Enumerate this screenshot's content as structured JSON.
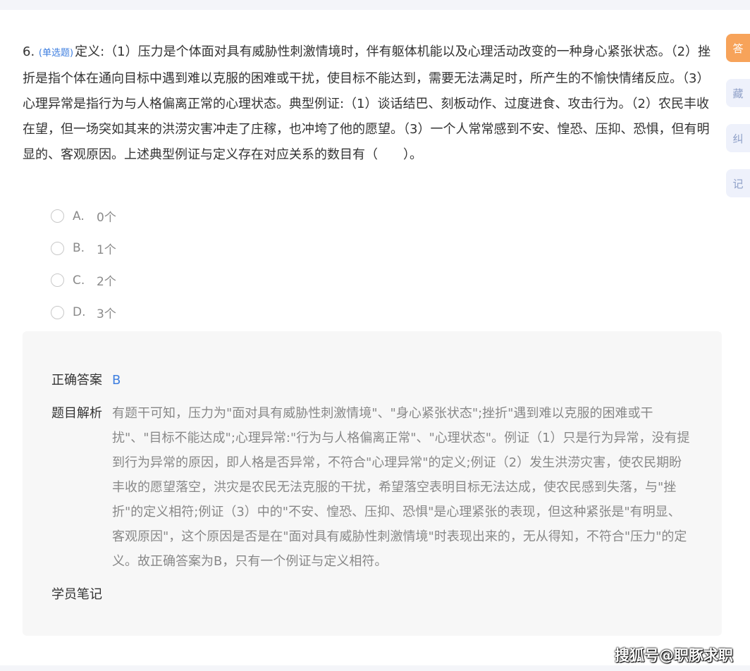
{
  "question": {
    "number": "6.",
    "type": "(单选题)",
    "text": "定义:（1）压力是个体面对具有威胁性刺激情境时，伴有躯体机能以及心理活动改变的一种身心紧张状态。（2）挫折是指个体在通向目标中遇到难以克服的困难或干扰，使目标不能达到，需要无法满足时，所产生的不愉快情绪反应。（3）心理异常是指行为与人格偏离正常的心理状态。典型例证:（1）谈话结巴、刻板动作、过度进食、攻击行为。（2）农民丰收在望，但一场突如其来的洪涝灾害冲走了庄稼，也冲垮了他的愿望。（3）一个人常常感到不安、惶恐、压抑、恐惧，但有明显的、客观原因。上述典型例证与定义存在对应关系的数目有（　　）。"
  },
  "options": [
    {
      "letter": "A.",
      "text": "0个"
    },
    {
      "letter": "B.",
      "text": "1个"
    },
    {
      "letter": "C.",
      "text": "2个"
    },
    {
      "letter": "D.",
      "text": "3个"
    }
  ],
  "analysis": {
    "answer_label": "正确答案",
    "answer_value": "B",
    "explanation_label": "题目解析",
    "explanation_text": "有题干可知，压力为\"面对具有威胁性刺激情境\"、\"身心紧张状态\";挫折\"遇到难以克服的困难或干扰\"、\"目标不能达成\";心理异常:\"行为与人格偏离正常\"、\"心理状态\"。例证（1）只是行为异常，没有提到行为异常的原因，即人格是否异常，不符合\"心理异常\"的定义;例证（2）发生洪涝灾害，使农民期盼丰收的愿望落空，洪灾是农民无法克服的干扰，希望落空表明目标无法达成，使农民感到失落，与\"挫折\"的定义相符;例证（3）中的\"不安、惶恐、压抑、恐惧\"是心理紧张的表现，但这种紧张是\"有明显、客观原因\"，这个原因是否是在\"面对具有威胁性刺激情境\"时表现出来的，无从得知，不符合\"压力\"的定义。故正确答案为B，只有一个例证与定义相符。",
    "notes_label": "学员笔记"
  },
  "side_tabs": [
    {
      "label": "答",
      "active": true
    },
    {
      "label": "藏",
      "active": false
    },
    {
      "label": "纠",
      "active": false
    },
    {
      "label": "记",
      "active": false
    }
  ],
  "watermark": "搜狐号@职豚求职",
  "colors": {
    "accent": "#3f7fe0",
    "active_tab": "#f7a35a"
  }
}
